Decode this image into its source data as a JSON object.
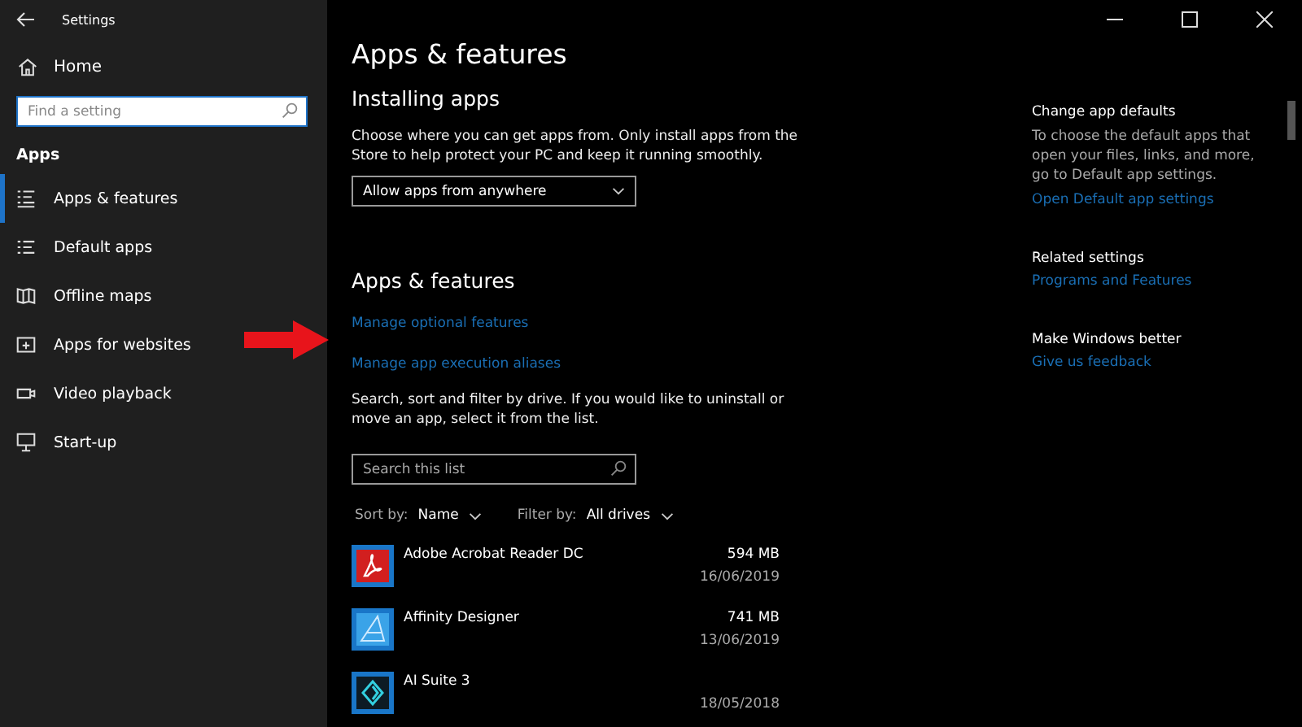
{
  "window": {
    "title": "Settings"
  },
  "sidebar": {
    "home": "Home",
    "search": {
      "placeholder": "Find a setting"
    },
    "section": "Apps",
    "items": [
      {
        "label": "Apps & features",
        "selected": true
      },
      {
        "label": "Default apps",
        "selected": false
      },
      {
        "label": "Offline maps",
        "selected": false
      },
      {
        "label": "Apps for websites",
        "selected": false
      },
      {
        "label": "Video playback",
        "selected": false
      },
      {
        "label": "Start-up",
        "selected": false
      }
    ]
  },
  "main": {
    "title": "Apps & features",
    "installing": {
      "heading": "Installing apps",
      "description": "Choose where you can get apps from. Only install apps from the Store to help protect your PC and keep it running smoothly.",
      "dropdown": "Allow apps from anywhere"
    },
    "features": {
      "heading": "Apps & features",
      "links": [
        "Manage optional features",
        "Manage app execution aliases"
      ],
      "description": "Search, sort and filter by drive. If you would like to uninstall or move an app, select it from the list.",
      "search": {
        "placeholder": "Search this list"
      },
      "sort": {
        "label": "Sort by:",
        "value": "Name"
      },
      "filter": {
        "label": "Filter by:",
        "value": "All drives"
      },
      "apps": [
        {
          "name": "Adobe Acrobat Reader DC",
          "size": "594 MB",
          "date": "16/06/2019"
        },
        {
          "name": "Affinity Designer",
          "size": "741 MB",
          "date": "13/06/2019"
        },
        {
          "name": "AI Suite 3",
          "date": "18/05/2018"
        }
      ]
    }
  },
  "side": {
    "sections": [
      {
        "heading": "Change app defaults",
        "text": "To choose the default apps that open your files, links, and more, go to Default app settings.",
        "link": "Open Default app settings"
      },
      {
        "heading": "Related settings",
        "link": "Programs and Features"
      },
      {
        "heading": "Make Windows better",
        "link": "Give us feedback"
      }
    ]
  }
}
